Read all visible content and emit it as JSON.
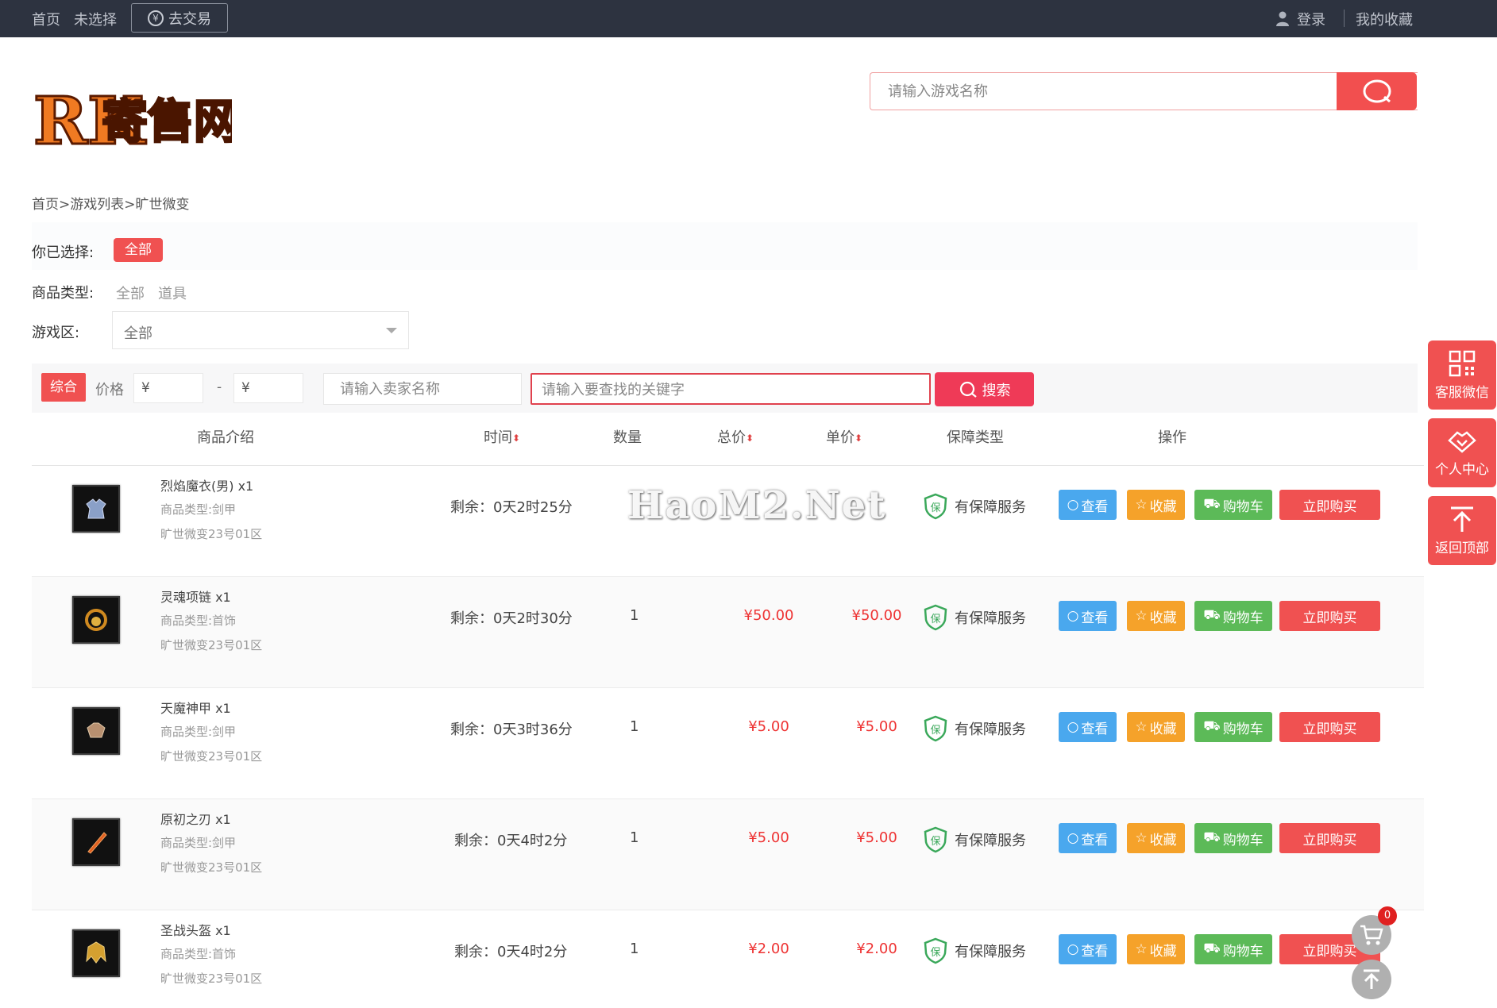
{
  "topbar": {
    "home": "首页",
    "unselected": "未选择",
    "trade": "去交易",
    "login": "登录",
    "favorites": "我的收藏"
  },
  "logo": {
    "text": "寄售网",
    "mark": "RK"
  },
  "search": {
    "placeholder": "请输入游戏名称"
  },
  "breadcrumb": {
    "home": "首页",
    "list": "游戏列表",
    "current": "旷世微变",
    "sep": ">"
  },
  "filters": {
    "selected_label": "你已选择:",
    "selected_value": "全部",
    "type_label": "商品类型:",
    "type_options": [
      "全部",
      "道具"
    ],
    "zone_label": "游戏区:",
    "zone_value": "全部"
  },
  "toolbar": {
    "sort_label": "综合",
    "price_label": "价格",
    "price_min": "¥",
    "price_max": "¥",
    "dash": "-",
    "seller_placeholder": "请输入卖家名称",
    "keyword_placeholder": "请输入要查找的关键字",
    "search_label": "搜索"
  },
  "table": {
    "headers": {
      "intro": "商品介绍",
      "time": "时间",
      "qty": "数量",
      "total": "总价",
      "unit": "单价",
      "guarantee": "保障类型",
      "ops": "操作"
    },
    "rows": [
      {
        "name": "烈焰魔衣(男) x1",
        "type": "商品类型:剑甲",
        "zone": "旷世微变23号01区",
        "time": "剩余：0天2时25分",
        "qty": "",
        "total": "",
        "unit": "",
        "guarantee": "有保障服务"
      },
      {
        "name": "灵魂项链 x1",
        "type": "商品类型:首饰",
        "zone": "旷世微变23号01区",
        "time": "剩余：0天2时30分",
        "qty": "1",
        "total": "¥50.00",
        "unit": "¥50.00",
        "guarantee": "有保障服务"
      },
      {
        "name": "天魔神甲 x1",
        "type": "商品类型:剑甲",
        "zone": "旷世微变23号01区",
        "time": "剩余：0天3时36分",
        "qty": "1",
        "total": "¥5.00",
        "unit": "¥5.00",
        "guarantee": "有保障服务"
      },
      {
        "name": "原初之刃 x1",
        "type": "商品类型:剑甲",
        "zone": "旷世微变23号01区",
        "time": "剩余：0天4时2分",
        "qty": "1",
        "total": "¥5.00",
        "unit": "¥5.00",
        "guarantee": "有保障服务"
      },
      {
        "name": "圣战头盔 x1",
        "type": "商品类型:首饰",
        "zone": "旷世微变23号01区",
        "time": "剩余：0天4时2分",
        "qty": "1",
        "total": "¥2.00",
        "unit": "¥2.00",
        "guarantee": "有保障服务"
      }
    ],
    "buttons": {
      "view": "查看",
      "favorite": "收藏",
      "cart": "购物车",
      "buy": "立即购买"
    }
  },
  "watermark": "HaoM2.Net",
  "side": {
    "wechat": "客服微信",
    "center": "个人中心",
    "top": "返回顶部",
    "cart_count": "0"
  },
  "colors": {
    "accent": "#f05151",
    "topbar": "#2d3340",
    "view": "#4aa8ee",
    "fav": "#f5a22a",
    "cart": "#5cba58"
  }
}
